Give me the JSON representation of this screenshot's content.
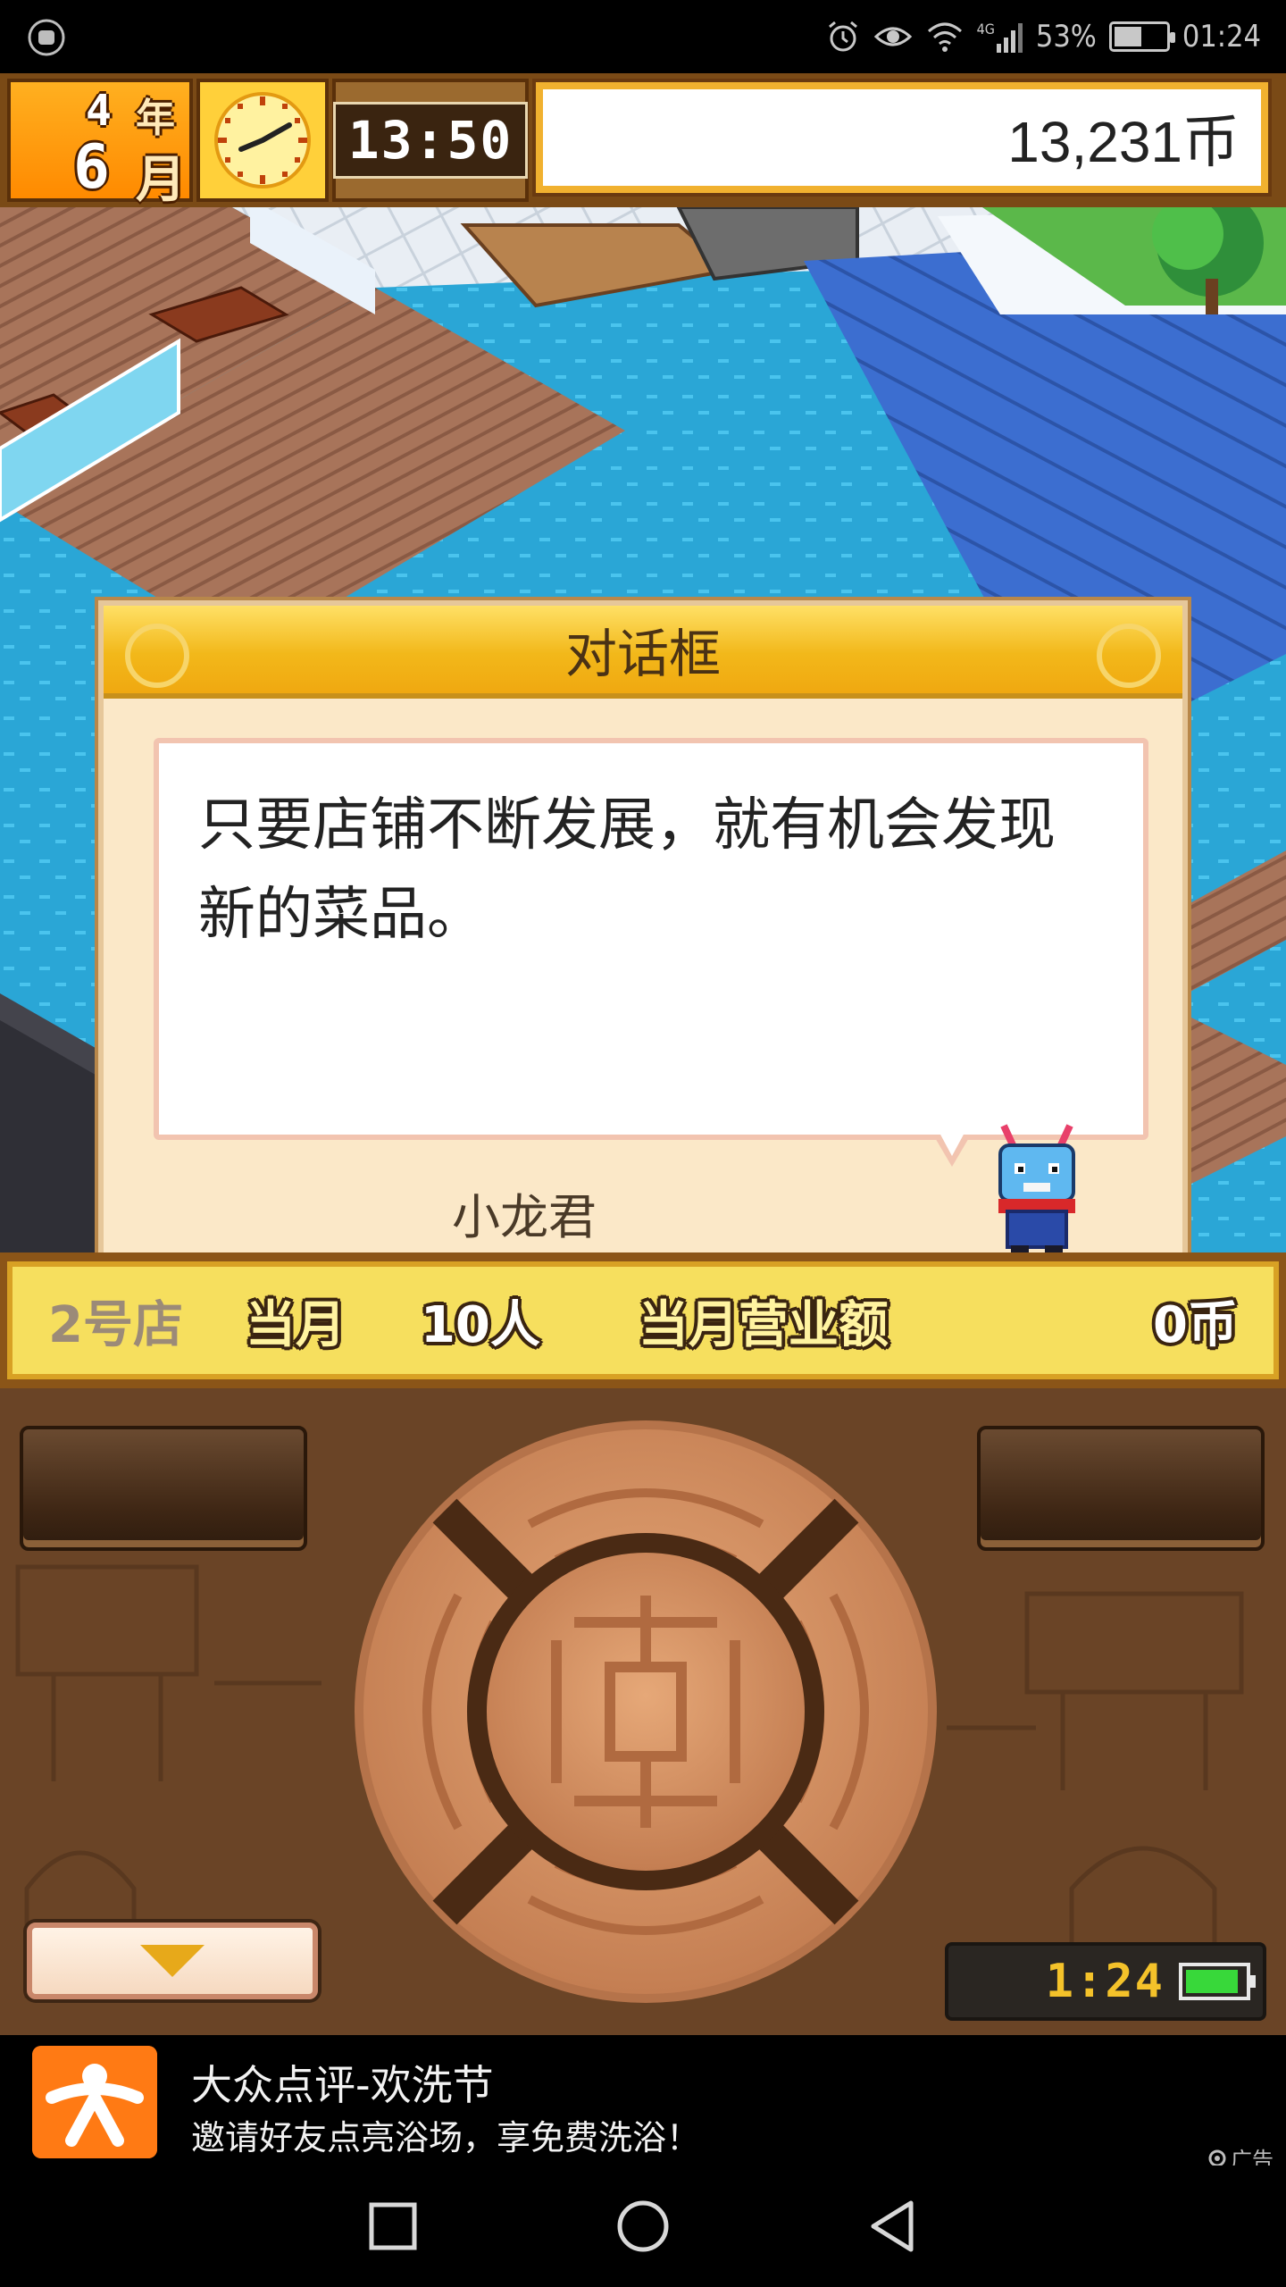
{
  "status_bar": {
    "network": "4G",
    "battery": "53%",
    "battery_level": 0.53,
    "time": "01:24"
  },
  "hud": {
    "year_value": "4",
    "year_label": "年",
    "month_value": "6",
    "month_label": "月",
    "game_time": "13:50",
    "money": "13,231币"
  },
  "dialog": {
    "title": "对话框",
    "message": "只要店铺不断发展，就有机会发现新的菜品。",
    "speaker": "小龙君"
  },
  "info_bar": {
    "store": "2号店",
    "month_label": "当月",
    "visitors": "10人",
    "revenue_label": "当月营业额",
    "revenue": "0币"
  },
  "controls": {
    "clock": "1:24",
    "menu_icon": "triangle-down-icon"
  },
  "ad": {
    "title": "大众点评-欢洗节",
    "subtitle": "邀请好友点亮浴场，享免费洗浴！",
    "tag": "广告"
  },
  "nav": {
    "recents_icon": "square-icon",
    "home_icon": "circle-icon",
    "back_icon": "triangle-back-icon"
  }
}
